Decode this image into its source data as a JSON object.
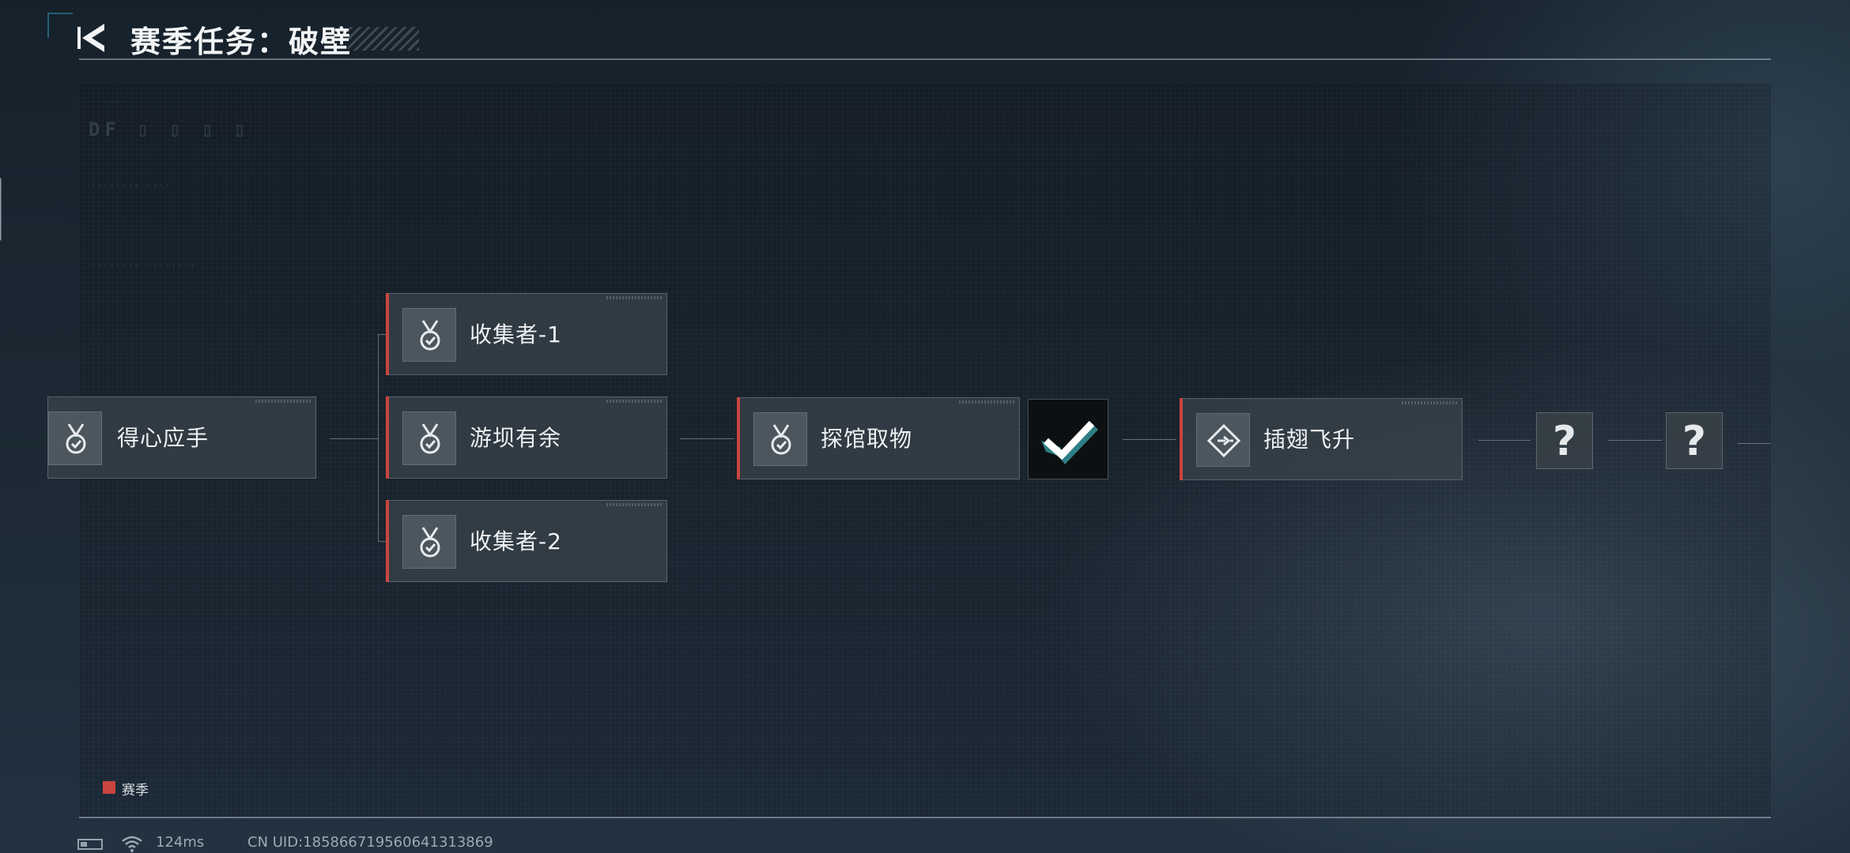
{
  "header": {
    "title": "赛季任务：破壁"
  },
  "missions": [
    {
      "id": "m1",
      "label": "得心应手",
      "icon": "medal-check-icon"
    },
    {
      "id": "m2",
      "label": "收集者-1",
      "icon": "medal-check-icon"
    },
    {
      "id": "m3",
      "label": "游坝有余",
      "icon": "medal-check-icon"
    },
    {
      "id": "m4",
      "label": "收集者-2",
      "icon": "medal-check-icon"
    },
    {
      "id": "m5",
      "label": "探馆取物",
      "icon": "medal-check-icon"
    },
    {
      "id": "m6",
      "label": "插翅飞升",
      "icon": "diamond-arrow-icon"
    }
  ],
  "reward": {
    "icon": "checkmark-icon",
    "status": "completed"
  },
  "locked_nodes": [
    {
      "label": "?"
    },
    {
      "label": "?"
    }
  ],
  "legend": {
    "label": "赛季",
    "color": "#c9453f"
  },
  "status_bar": {
    "ping": "124ms",
    "uid": "CN UID:1858667195606413138​69"
  },
  "colors": {
    "accent_red": "#c9453f",
    "card_bg": "#3a444c",
    "reward_bg": "#0c1013"
  }
}
